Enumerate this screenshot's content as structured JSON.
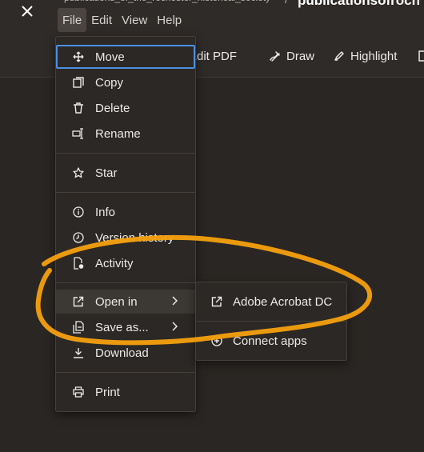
{
  "header": {
    "breadcrumb": "publications_of_the_rochester_historical_society",
    "breadcrumb_sep": "/",
    "doc_title": "publicationsofroch"
  },
  "menubar": {
    "file": "File",
    "edit": "Edit",
    "view": "View",
    "help": "Help"
  },
  "toolbar": {
    "edit_pdf": "Edit PDF",
    "draw": "Draw",
    "highlight": "Highlight"
  },
  "file_menu": {
    "move": "Move",
    "copy": "Copy",
    "delete": "Delete",
    "rename": "Rename",
    "star": "Star",
    "info": "Info",
    "version_history": "Version history",
    "activity": "Activity",
    "open_in": "Open in",
    "save_as": "Save as...",
    "download": "Download",
    "print": "Print"
  },
  "open_in_submenu": {
    "adobe_acrobat": "Adobe Acrobat DC",
    "connect_apps": "Connect apps"
  },
  "colors": {
    "background": "#2a2623",
    "menu": "#2c2825",
    "focus_ring": "#4b8fe0",
    "annotation": "#f5a00e"
  },
  "icons": {
    "close": "close-icon",
    "move": "move-icon",
    "copy": "copy-icon",
    "delete": "trash-icon",
    "rename": "rename-icon",
    "star": "star-icon",
    "info": "info-icon",
    "version_history": "clock-icon",
    "activity": "activity-icon",
    "open_in": "external-link-icon",
    "save_as": "save-as-icon",
    "download": "download-icon",
    "print": "print-icon",
    "chevron": "chevron-right-icon",
    "adobe_acrobat": "external-link-icon",
    "connect_apps": "plus-circle-icon"
  }
}
